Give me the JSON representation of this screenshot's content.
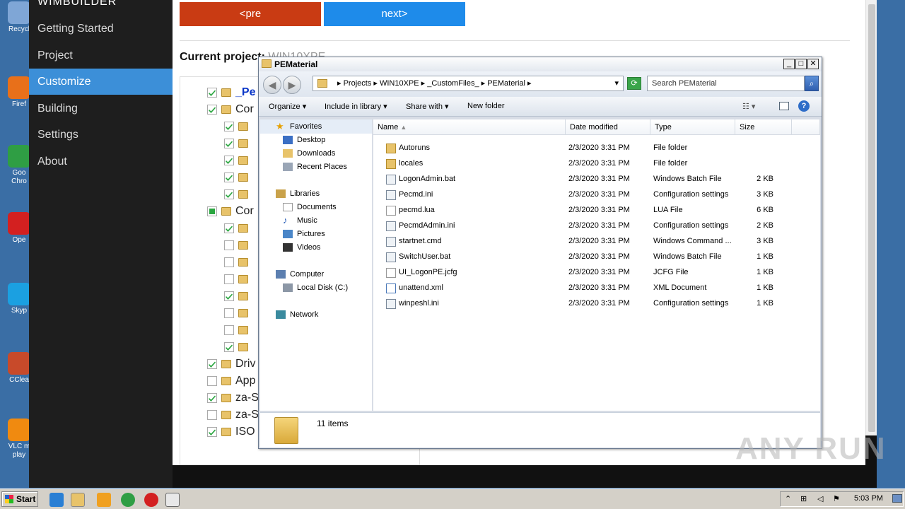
{
  "desktop_icons": [
    {
      "label": "Recycl",
      "color": "#7fa6d6"
    },
    {
      "label": "Firef",
      "color": "#e8701a"
    },
    {
      "label": "Goo\nChro",
      "color": "#2f9e44"
    },
    {
      "label": "Ope",
      "color": "#d32020"
    },
    {
      "label": "Skyp",
      "color": "#1ba0e1"
    },
    {
      "label": "CClea",
      "color": "#c84a2a"
    },
    {
      "label": "VLC m\nplay",
      "color": "#f08a10"
    }
  ],
  "app": {
    "brand": "WIMBUILDER",
    "nav": [
      "Getting Started",
      "Project",
      "Customize",
      "Building",
      "Settings",
      "About"
    ],
    "active_nav": "Customize",
    "pre_label": "<pre",
    "next_label": "next>",
    "current_project_label": "Current project:",
    "current_project_value": "WIN10XPE",
    "tree": [
      {
        "label": "_Pe",
        "checked": true,
        "level": 0,
        "link": true
      },
      {
        "label": "Cor",
        "checked": true,
        "level": 0
      },
      {
        "label": "",
        "checked": true,
        "level": 1
      },
      {
        "label": "",
        "checked": true,
        "level": 1
      },
      {
        "label": "",
        "checked": true,
        "level": 1
      },
      {
        "label": "",
        "checked": true,
        "level": 1
      },
      {
        "label": "",
        "checked": true,
        "level": 1
      },
      {
        "label": "Cor",
        "checked": "partial",
        "level": 0
      },
      {
        "label": "",
        "checked": true,
        "level": 1
      },
      {
        "label": "",
        "checked": false,
        "level": 1
      },
      {
        "label": "",
        "checked": false,
        "level": 1
      },
      {
        "label": "",
        "checked": false,
        "level": 1
      },
      {
        "label": "",
        "checked": true,
        "level": 1
      },
      {
        "label": "",
        "checked": false,
        "level": 1
      },
      {
        "label": "",
        "checked": false,
        "level": 1
      },
      {
        "label": "",
        "checked": true,
        "level": 1
      },
      {
        "label": "Driv",
        "checked": true,
        "level": 0
      },
      {
        "label": "App",
        "checked": false,
        "level": 0
      },
      {
        "label": "za-S",
        "checked": true,
        "level": 0
      },
      {
        "label": "za-S",
        "checked": false,
        "level": 0
      },
      {
        "label": "ISO",
        "checked": true,
        "level": 0
      }
    ]
  },
  "explorer": {
    "title": "PEMaterial",
    "breadcrumb": "▸ Projects ▸ WIN10XPE ▸ _CustomFiles_ ▸ PEMaterial ▸",
    "search_placeholder": "Search PEMaterial",
    "toolbar": [
      "Organize ▾",
      "Include in library ▾",
      "Share with ▾",
      "New folder"
    ],
    "nav": {
      "favorites": "Favorites",
      "desktop": "Desktop",
      "downloads": "Downloads",
      "recent": "Recent Places",
      "libraries": "Libraries",
      "documents": "Documents",
      "music": "Music",
      "pictures": "Pictures",
      "videos": "Videos",
      "computer": "Computer",
      "localdisk": "Local Disk (C:)",
      "network": "Network"
    },
    "columns": [
      "Name",
      "Date modified",
      "Type",
      "Size"
    ],
    "files": [
      {
        "name": "Autoruns",
        "date": "2/3/2020 3:31 PM",
        "type": "File folder",
        "size": "",
        "kind": "folder"
      },
      {
        "name": "locales",
        "date": "2/3/2020 3:31 PM",
        "type": "File folder",
        "size": "",
        "kind": "folder"
      },
      {
        "name": "LogonAdmin.bat",
        "date": "2/3/2020 3:31 PM",
        "type": "Windows Batch File",
        "size": "2 KB",
        "kind": "gear"
      },
      {
        "name": "Pecmd.ini",
        "date": "2/3/2020 3:31 PM",
        "type": "Configuration settings",
        "size": "3 KB",
        "kind": "gear"
      },
      {
        "name": "pecmd.lua",
        "date": "2/3/2020 3:31 PM",
        "type": "LUA File",
        "size": "6 KB",
        "kind": "doc"
      },
      {
        "name": "PecmdAdmin.ini",
        "date": "2/3/2020 3:31 PM",
        "type": "Configuration settings",
        "size": "2 KB",
        "kind": "gear"
      },
      {
        "name": "startnet.cmd",
        "date": "2/3/2020 3:31 PM",
        "type": "Windows Command ...",
        "size": "3 KB",
        "kind": "gear"
      },
      {
        "name": "SwitchUser.bat",
        "date": "2/3/2020 3:31 PM",
        "type": "Windows Batch File",
        "size": "1 KB",
        "kind": "gear"
      },
      {
        "name": "UI_LogonPE.jcfg",
        "date": "2/3/2020 3:31 PM",
        "type": "JCFG File",
        "size": "1 KB",
        "kind": "doc"
      },
      {
        "name": "unattend.xml",
        "date": "2/3/2020 3:31 PM",
        "type": "XML Document",
        "size": "1 KB",
        "kind": "xml"
      },
      {
        "name": "winpeshl.ini",
        "date": "2/3/2020 3:31 PM",
        "type": "Configuration settings",
        "size": "1 KB",
        "kind": "gear"
      }
    ],
    "status": "11 items"
  },
  "taskbar": {
    "start": "Start",
    "clock": "5:03 PM"
  },
  "watermark": "ANY RUN"
}
